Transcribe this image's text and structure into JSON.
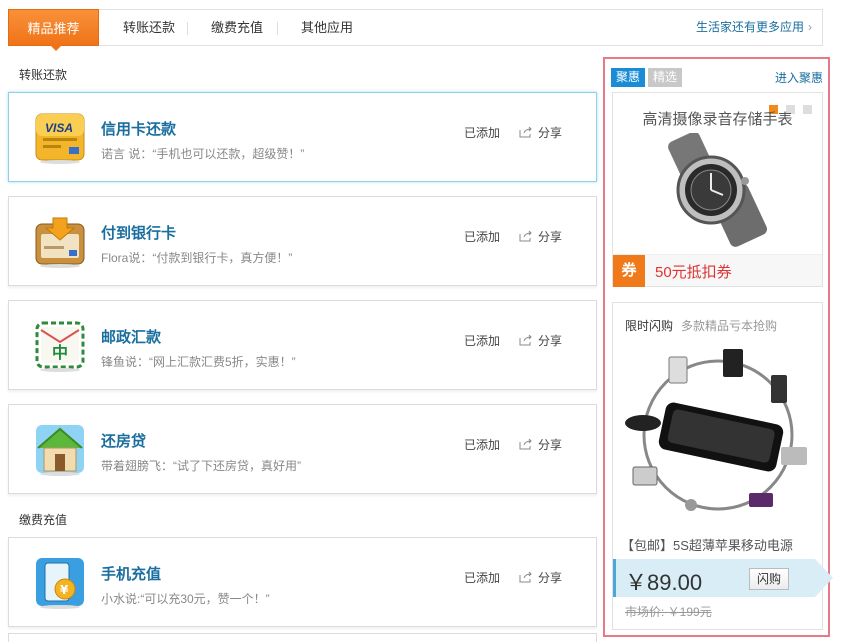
{
  "tabs": [
    {
      "label": "精品推荐",
      "active": true
    },
    {
      "label": "转账还款"
    },
    {
      "label": "缴费充值"
    },
    {
      "label": "其他应用"
    }
  ],
  "more_apps": "生活家还有更多应用",
  "sections": {
    "transfer": "转账还款",
    "payment": "缴费充值"
  },
  "cards": [
    {
      "name": "信用卡还款",
      "quote": "诺言 说：“手机也可以还款，超级赞！”",
      "added": "已添加",
      "share": "分享",
      "icon": "visa-card-icon"
    },
    {
      "name": "付到银行卡",
      "quote": "Flora说：“付款到银行卡，真方便！”",
      "added": "已添加",
      "share": "分享",
      "icon": "bank-card-transfer-icon"
    },
    {
      "name": "邮政汇款",
      "quote": "锋鱼说：“网上汇款汇费5折，实惠！”",
      "added": "已添加",
      "share": "分享",
      "icon": "postal-envelope-icon"
    },
    {
      "name": "还房贷",
      "quote": "带着翅膀飞：“试了下还房贷，真好用”",
      "added": "已添加",
      "share": "分享",
      "icon": "house-icon"
    },
    {
      "name": "手机充值",
      "quote": "小水说:“可以充30元，赞一个！”",
      "added": "已添加",
      "share": "分享",
      "icon": "phone-recharge-icon"
    }
  ],
  "side": {
    "tab_on": "聚惠",
    "tab_off": "精选",
    "enter_link": "进入聚惠",
    "promo1": {
      "title": "高清摄像录音存储手表",
      "coupon_badge": "券",
      "coupon_text": "50元抵扣券"
    },
    "promo2": {
      "flash_title": "限时闪购",
      "flash_sub": "多款精品亏本抢购",
      "product_name": "【包邮】5S超薄苹果移动电源",
      "price": "￥89.00",
      "buy_label": "闪购",
      "orig_price": "市场价: ￥199元"
    }
  },
  "colors": {
    "accent_orange": "#ef7318",
    "link_blue": "#1a6e9e",
    "panel_border": "#e67a86"
  }
}
